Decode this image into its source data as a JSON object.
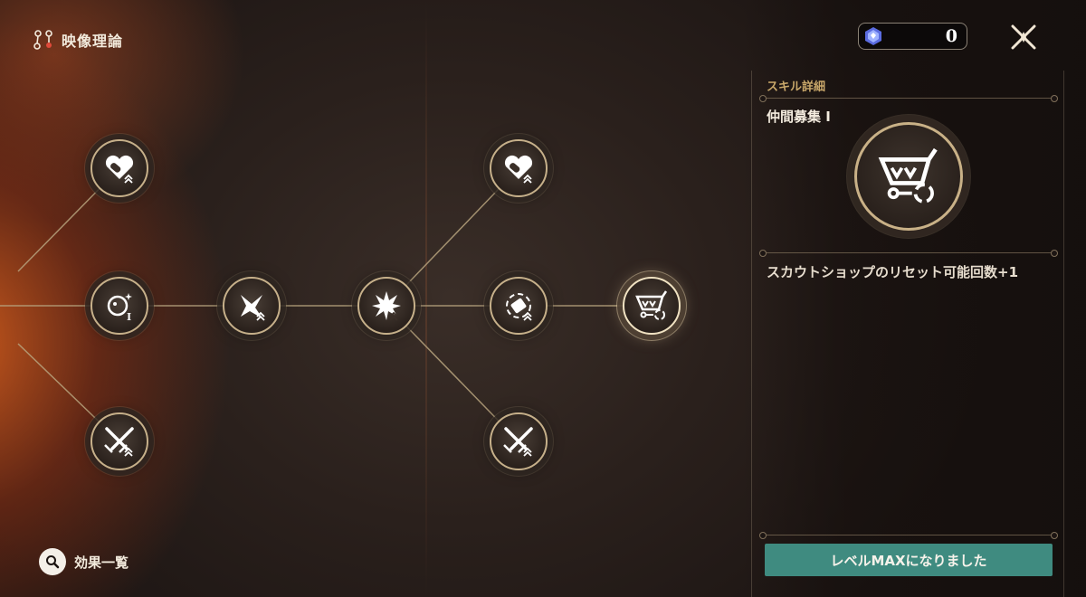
{
  "header": {
    "title": "映像理論"
  },
  "currency": {
    "amount": "0"
  },
  "nodes": {
    "top_left_label": "heart-key",
    "roman_I": "I"
  },
  "panel": {
    "heading": "スキル詳細",
    "skill_name": "仲間募集 I",
    "description": "スカウトショップのリセット可能回数+1",
    "max_button": "レベルMAXになりました"
  },
  "footer": {
    "effects_label": "効果一覧"
  },
  "colors": {
    "accent_gold": "#c6b08a",
    "button_teal": "#3f8b80",
    "heading_gold": "#c9a86a"
  }
}
